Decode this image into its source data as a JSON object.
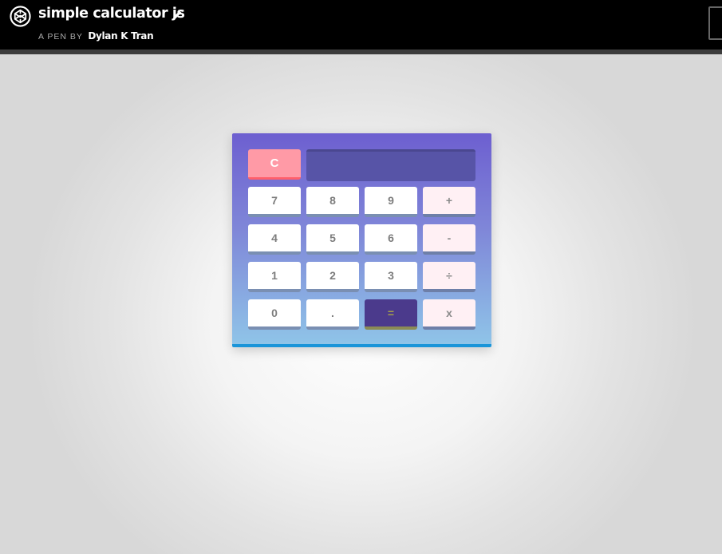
{
  "header": {
    "title": "simple calculator js",
    "byline_label": "A PEN BY",
    "author": "Dylan K Tran",
    "logo_icon": "codepen-logo-icon",
    "edit_icon": "pencil-icon"
  },
  "calculator": {
    "display_value": "",
    "clear_label": "C",
    "keys": {
      "seven": "7",
      "eight": "8",
      "nine": "9",
      "plus": "+",
      "four": "4",
      "five": "5",
      "six": "6",
      "minus": "-",
      "one": "1",
      "two": "2",
      "three": "3",
      "divide": "÷",
      "zero": "0",
      "dot": ".",
      "equals": "=",
      "multiply": "x"
    },
    "colors": {
      "gradient_top": "#6d5fd0",
      "gradient_bottom": "#8fc4e8",
      "clear_key": "#ff9aa6",
      "equals_key": "#4b3a8c",
      "display": "#5754a7",
      "accent_border": "#1a95d9"
    }
  }
}
